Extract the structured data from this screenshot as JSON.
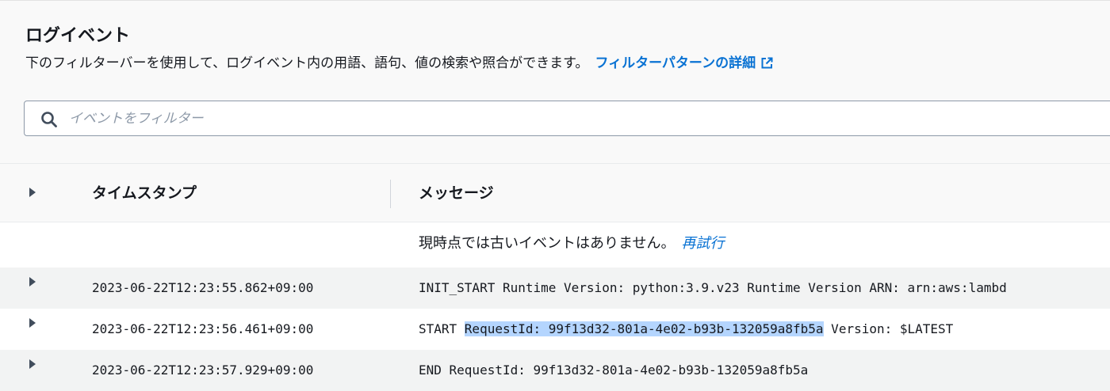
{
  "header": {
    "title": "ログイベント",
    "description": "下のフィルターバーを使用して、ログイベント内の用語、語句、値の検索や照合ができます。",
    "learn_more_link": "フィルターパターンの詳細"
  },
  "search": {
    "placeholder": "イベントをフィルター",
    "value": ""
  },
  "table": {
    "columns": {
      "timestamp": "タイムスタンプ",
      "message": "メッセージ"
    },
    "info_message": "現時点では古いイベントはありません。",
    "retry_link": "再試行",
    "rows": [
      {
        "timestamp": "2023-06-22T12:23:55.862+09:00",
        "message": "INIT_START Runtime Version: python:3.9.v23 Runtime Version ARN: arn:aws:lambd"
      },
      {
        "timestamp": "2023-06-22T12:23:56.461+09:00",
        "message_prefix": "START ",
        "message_highlight": "RequestId: 99f13d32-801a-4e02-b93b-132059a8fb5a",
        "message_suffix": " Version: $LATEST"
      },
      {
        "timestamp": "2023-06-22T12:23:57.929+09:00",
        "message": "END RequestId: 99f13d32-801a-4e02-b93b-132059a8fb5a"
      }
    ]
  },
  "icons": {
    "search": "search-icon",
    "external": "external-link-icon",
    "expand": "caret-right-icon"
  },
  "colors": {
    "link": "#0972d3",
    "selection": "#b4d5fe",
    "header_bg": "#f9f9f9",
    "row_shaded": "#f2f3f3"
  }
}
